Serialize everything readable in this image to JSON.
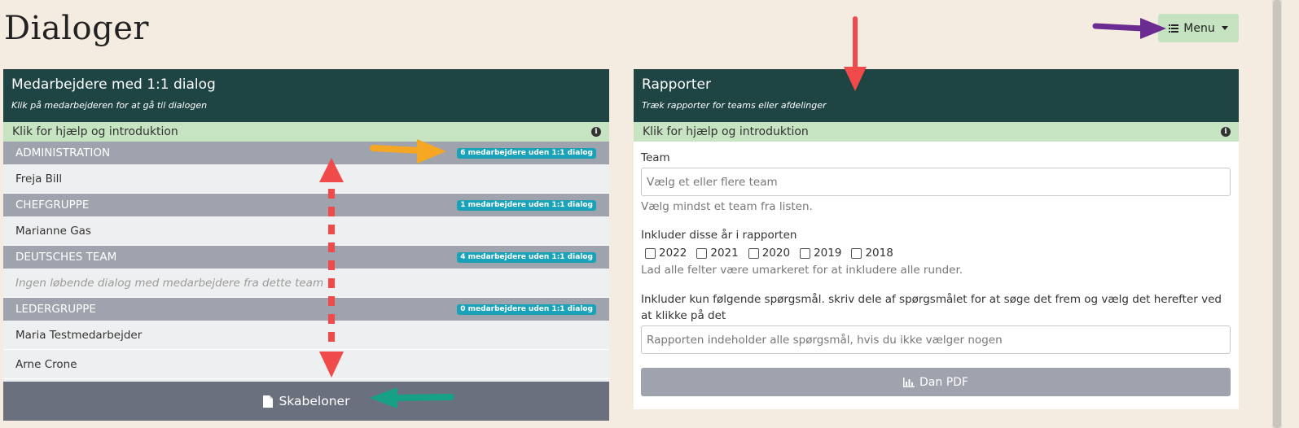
{
  "page": {
    "title": "Dialoger"
  },
  "menu": {
    "label": "Menu",
    "icon": "list-icon"
  },
  "left_card": {
    "title": "Medarbejdere med 1:1 dialog",
    "subtitle": "Klik på medarbejderen for at gå til dialogen",
    "help": "Klik for hjælp og introduktion",
    "groups": [
      {
        "name": "ADMINISTRATION",
        "badge": "6 medarbejdere uden 1:1 dialog",
        "members": [
          "Freja Bill"
        ]
      },
      {
        "name": "CHEFGRUPPE",
        "badge": "1 medarbejdere uden 1:1 dialog",
        "members": [
          "Marianne Gas"
        ]
      },
      {
        "name": "DEUTSCHES TEAM",
        "badge": "4 medarbejdere uden 1:1 dialog",
        "empty": "Ingen løbende dialog med medarbejdere fra dette team"
      },
      {
        "name": "LEDERGRUPPE",
        "badge": "0 medarbejdere uden 1:1 dialog",
        "members": [
          "Maria Testmedarbejder",
          "Arne Crone"
        ]
      }
    ],
    "templates_button": "Skabeloner"
  },
  "right_card": {
    "title": "Rapporter",
    "subtitle": "Træk rapporter for teams eller afdelinger",
    "help": "Klik for hjælp og introduktion",
    "team_label": "Team",
    "team_placeholder": "Vælg et eller flere team",
    "team_hint": "Vælg mindst et team fra listen.",
    "years_label": "Inkluder disse år i rapporten",
    "years": [
      "2022",
      "2021",
      "2020",
      "2019",
      "2018"
    ],
    "years_hint": "Lad alle felter være umarkeret for at inkludere alle runder.",
    "questions_label": "Inkluder kun følgende spørgsmål. skriv dele af spørgsmålet for at søge det frem og vælg det herefter ved at klikke på det",
    "questions_placeholder": "Rapporten indeholder alle spørgsmål, hvis du ikke vælger nogen",
    "pdf_button": "Dan PDF"
  },
  "colors": {
    "background": "#f5ece1",
    "card_header": "#1e4543",
    "help_bar": "#c6e4c1",
    "group_header": "#9ea3ad",
    "badge": "#1aa3b8",
    "annotation_red": "#f04a4a",
    "annotation_orange": "#f5a623",
    "annotation_green": "#16a085",
    "annotation_purple": "#6a2c91"
  }
}
